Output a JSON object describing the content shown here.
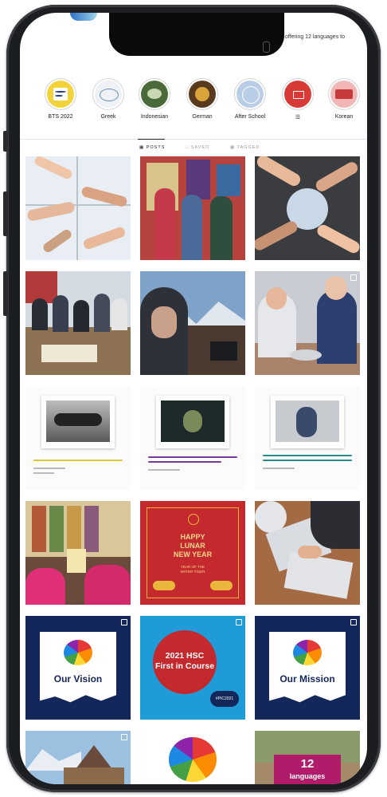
{
  "status": {
    "caption": "offering 12 languages to"
  },
  "highlights": [
    {
      "label": "BTS 2022",
      "color": "#f3d33a"
    },
    {
      "label": "Greek",
      "color": "#dfe6ee"
    },
    {
      "label": "Indonesian",
      "color": "#5a7a4a"
    },
    {
      "label": "German",
      "color": "#6b4a2a"
    },
    {
      "label": "After School",
      "color": "#b9cde6"
    },
    {
      "label": "☰",
      "color": "#d83b36"
    },
    {
      "label": "Korean",
      "color": "#d96a6a"
    }
  ],
  "tabs": [
    {
      "label": "POSTS",
      "icon": "grid-icon",
      "active": true
    },
    {
      "label": "SAVED",
      "icon": "bookmark-icon",
      "active": false
    },
    {
      "label": "TAGGED",
      "icon": "tag-icon",
      "active": false
    }
  ],
  "posts": {
    "lunar": {
      "line1": "HAPPY",
      "line2": "LUNAR",
      "line3": "NEW YEAR",
      "sub1": "YEAR OF THE",
      "sub2": "WATER TIGER"
    },
    "vision": {
      "text": "Our Vision"
    },
    "hsc": {
      "line1": "2021 HSC",
      "line2": "First in Course",
      "tag": "#PIC2021"
    },
    "mission": {
      "text": "Our Mission"
    },
    "languages": {
      "number": "12",
      "word": "languages"
    }
  },
  "colors": {
    "navy": "#14275a",
    "crimson": "#c4292e",
    "sky": "#1f9bd8",
    "magenta": "#b01c6a"
  }
}
